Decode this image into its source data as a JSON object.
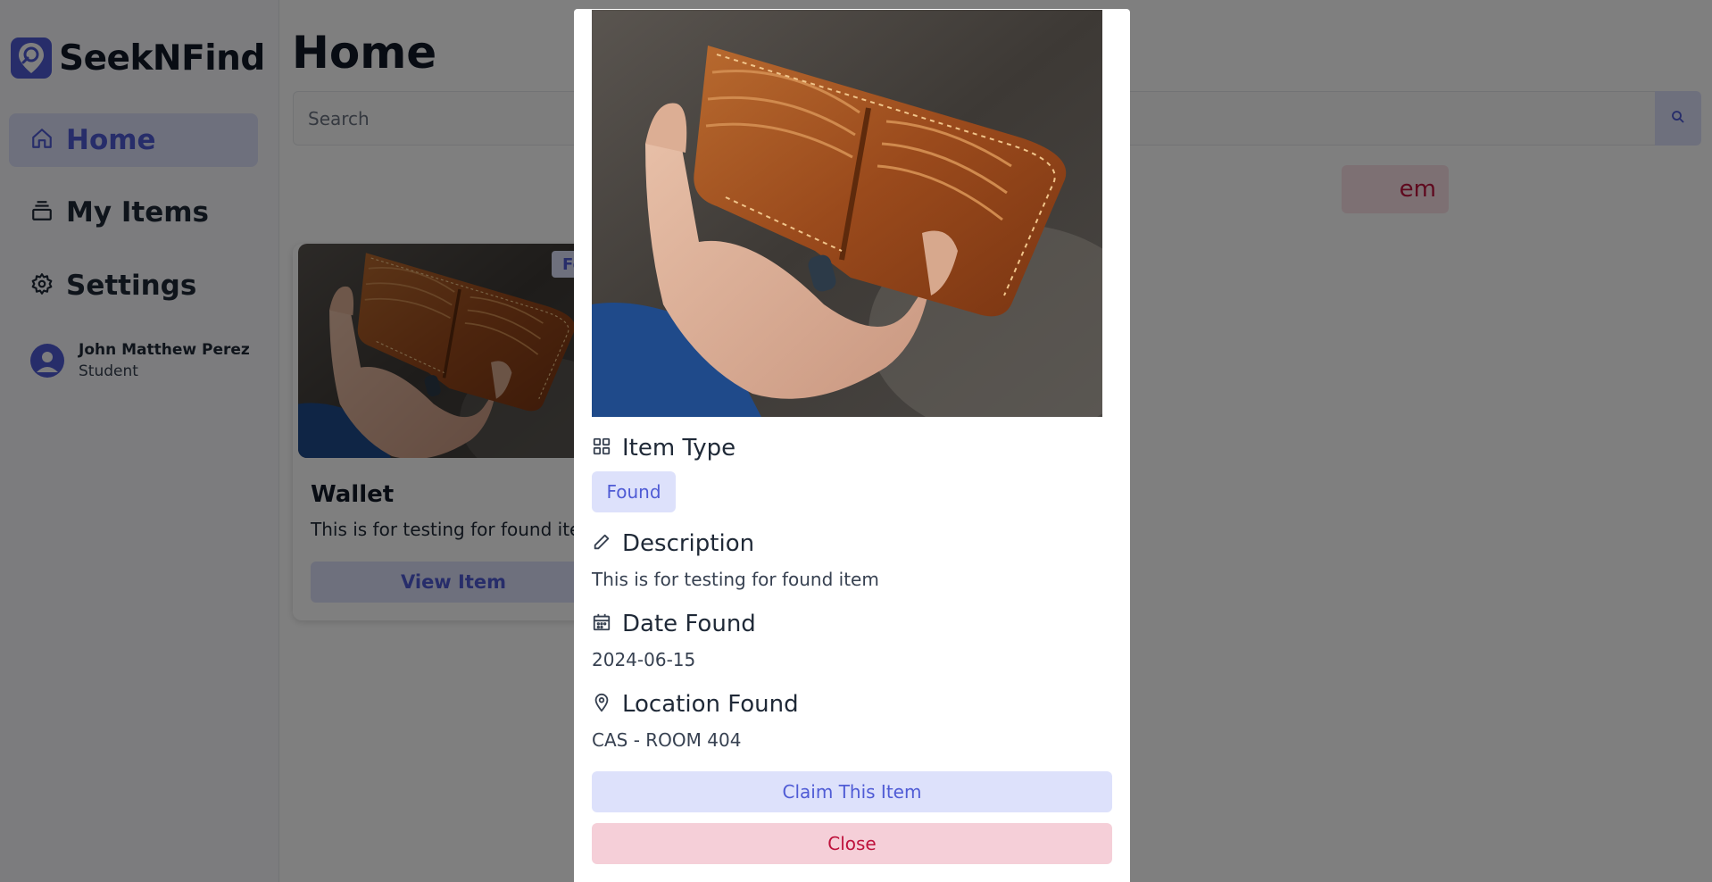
{
  "app": {
    "name": "SeekNFind"
  },
  "sidebar": {
    "items": [
      {
        "label": "Home",
        "icon": "home-icon",
        "active": true
      },
      {
        "label": "My Items",
        "icon": "stack-icon",
        "active": false
      },
      {
        "label": "Settings",
        "icon": "gear-icon",
        "active": false
      }
    ],
    "user": {
      "name": "John Matthew Perez",
      "role": "Student"
    }
  },
  "main": {
    "title": "Home",
    "search": {
      "placeholder": "Search",
      "value": ""
    },
    "partial_button_label": "em",
    "card": {
      "badge": "Fo",
      "title": "Wallet",
      "description": "This is for testing for found item",
      "button_label": "View Item"
    }
  },
  "modal": {
    "item_type": {
      "label": "Item Type",
      "value": "Found"
    },
    "description": {
      "label": "Description",
      "value": "This is for testing for found item"
    },
    "date": {
      "label": "Date Found",
      "value": "2024-06-15"
    },
    "location": {
      "label": "Location Found",
      "value": "CAS - ROOM 404"
    },
    "claim_label": "Claim This Item",
    "close_label": "Close"
  },
  "colors": {
    "accent": "#4f5bd5",
    "accent_light": "#dde1fb",
    "danger": "#be123c",
    "danger_light": "#f5cfd8",
    "wallet_leather": "#9a4a1c"
  }
}
